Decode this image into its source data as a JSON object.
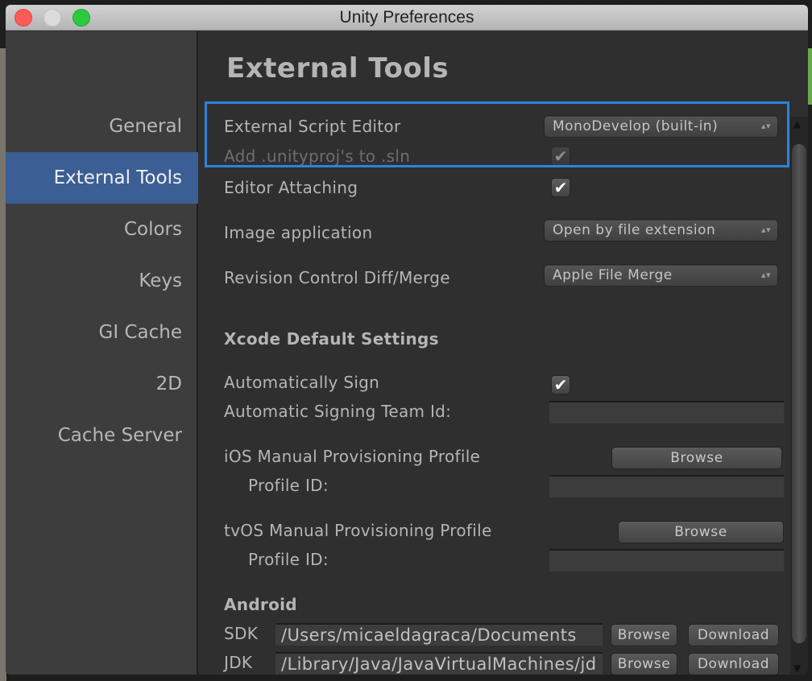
{
  "window": {
    "title": "Unity Preferences"
  },
  "sidebar": {
    "items": [
      {
        "label": "General",
        "active": false
      },
      {
        "label": "External Tools",
        "active": true
      },
      {
        "label": "Colors",
        "active": false
      },
      {
        "label": "Keys",
        "active": false
      },
      {
        "label": "GI Cache",
        "active": false
      },
      {
        "label": "2D",
        "active": false
      },
      {
        "label": "Cache Server",
        "active": false
      }
    ]
  },
  "main": {
    "title": "External Tools",
    "external_script_editor": {
      "label": "External Script Editor",
      "value": "MonoDevelop (built-in)"
    },
    "add_unityproj": {
      "label": "Add .unityproj's to .sln",
      "checked": true,
      "disabled": true
    },
    "editor_attaching": {
      "label": "Editor Attaching",
      "checked": true
    },
    "image_application": {
      "label": "Image application",
      "value": "Open by file extension"
    },
    "revision_control": {
      "label": "Revision Control Diff/Merge",
      "value": "Apple File Merge"
    },
    "xcode": {
      "heading": "Xcode Default Settings",
      "auto_sign": {
        "label": "Automatically Sign",
        "checked": true
      },
      "team_id": {
        "label": "Automatic Signing Team Id:",
        "value": ""
      },
      "ios_profile": {
        "label": "iOS Manual Provisioning Profile",
        "browse": "Browse",
        "profile_id_label": "Profile ID:",
        "profile_id": ""
      },
      "tvos_profile": {
        "label": "tvOS Manual Provisioning Profile",
        "browse": "Browse",
        "profile_id_label": "Profile ID:",
        "profile_id": ""
      }
    },
    "android": {
      "heading": "Android",
      "sdk": {
        "label": "SDK",
        "value": "/Users/micaeldagraca/Documents",
        "browse": "Browse",
        "download": "Download"
      },
      "jdk": {
        "label": "JDK",
        "value": "/Library/Java/JavaVirtualMachines/jd",
        "browse": "Browse",
        "download": "Download"
      }
    }
  },
  "icons": {
    "check": "✔",
    "updown": "▴▾",
    "scroll_up": "▲",
    "scroll_down": "▼"
  },
  "colors": {
    "accent": "#3b5e94",
    "highlight": "#2c83d9"
  }
}
